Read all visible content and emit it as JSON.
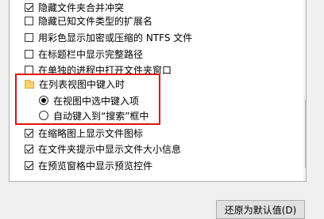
{
  "options": [
    {
      "type": "checkbox",
      "checked": true,
      "label": "隐藏文件夹合并冲突"
    },
    {
      "type": "checkbox",
      "checked": false,
      "label": "隐藏已知文件类型的扩展名"
    },
    {
      "type": "checkbox",
      "checked": false,
      "label": "用彩色显示加密或压缩的 NTFS 文件"
    },
    {
      "type": "checkbox",
      "checked": false,
      "label": "在标题栏中显示完整路径"
    },
    {
      "type": "checkbox",
      "checked": false,
      "label": "在单独的进程中打开文件夹窗口"
    },
    {
      "type": "folder",
      "label": "在列表视图中键入时"
    },
    {
      "type": "radio",
      "checked": true,
      "label": "在视图中选中键入项"
    },
    {
      "type": "radio",
      "checked": false,
      "label": "自动键入到“搜索”框中"
    },
    {
      "type": "checkbox",
      "checked": true,
      "label": "在缩略图上显示文件图标"
    },
    {
      "type": "checkbox",
      "checked": true,
      "label": "在文件夹提示中显示文件大小信息"
    },
    {
      "type": "checkbox",
      "checked": true,
      "label": "在预览窗格中显示预览控件"
    }
  ],
  "restore_button": "还原为默认值(D)",
  "colors": {
    "highlight": "#e01010"
  }
}
